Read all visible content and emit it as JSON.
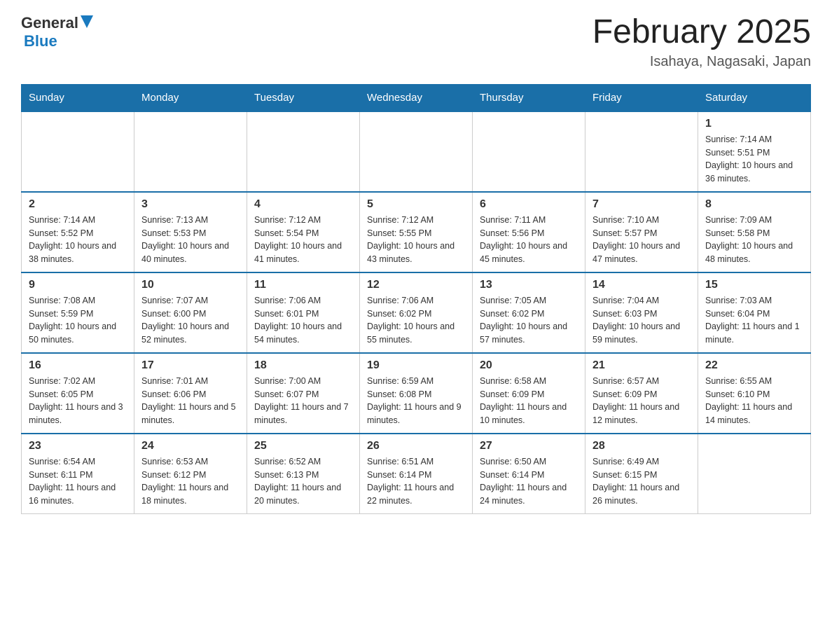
{
  "header": {
    "logo_general": "General",
    "logo_blue": "Blue",
    "title": "February 2025",
    "subtitle": "Isahaya, Nagasaki, Japan"
  },
  "weekdays": [
    "Sunday",
    "Monday",
    "Tuesday",
    "Wednesday",
    "Thursday",
    "Friday",
    "Saturday"
  ],
  "weeks": [
    [
      {
        "day": "",
        "info": ""
      },
      {
        "day": "",
        "info": ""
      },
      {
        "day": "",
        "info": ""
      },
      {
        "day": "",
        "info": ""
      },
      {
        "day": "",
        "info": ""
      },
      {
        "day": "",
        "info": ""
      },
      {
        "day": "1",
        "info": "Sunrise: 7:14 AM\nSunset: 5:51 PM\nDaylight: 10 hours\nand 36 minutes."
      }
    ],
    [
      {
        "day": "2",
        "info": "Sunrise: 7:14 AM\nSunset: 5:52 PM\nDaylight: 10 hours\nand 38 minutes."
      },
      {
        "day": "3",
        "info": "Sunrise: 7:13 AM\nSunset: 5:53 PM\nDaylight: 10 hours\nand 40 minutes."
      },
      {
        "day": "4",
        "info": "Sunrise: 7:12 AM\nSunset: 5:54 PM\nDaylight: 10 hours\nand 41 minutes."
      },
      {
        "day": "5",
        "info": "Sunrise: 7:12 AM\nSunset: 5:55 PM\nDaylight: 10 hours\nand 43 minutes."
      },
      {
        "day": "6",
        "info": "Sunrise: 7:11 AM\nSunset: 5:56 PM\nDaylight: 10 hours\nand 45 minutes."
      },
      {
        "day": "7",
        "info": "Sunrise: 7:10 AM\nSunset: 5:57 PM\nDaylight: 10 hours\nand 47 minutes."
      },
      {
        "day": "8",
        "info": "Sunrise: 7:09 AM\nSunset: 5:58 PM\nDaylight: 10 hours\nand 48 minutes."
      }
    ],
    [
      {
        "day": "9",
        "info": "Sunrise: 7:08 AM\nSunset: 5:59 PM\nDaylight: 10 hours\nand 50 minutes."
      },
      {
        "day": "10",
        "info": "Sunrise: 7:07 AM\nSunset: 6:00 PM\nDaylight: 10 hours\nand 52 minutes."
      },
      {
        "day": "11",
        "info": "Sunrise: 7:06 AM\nSunset: 6:01 PM\nDaylight: 10 hours\nand 54 minutes."
      },
      {
        "day": "12",
        "info": "Sunrise: 7:06 AM\nSunset: 6:02 PM\nDaylight: 10 hours\nand 55 minutes."
      },
      {
        "day": "13",
        "info": "Sunrise: 7:05 AM\nSunset: 6:02 PM\nDaylight: 10 hours\nand 57 minutes."
      },
      {
        "day": "14",
        "info": "Sunrise: 7:04 AM\nSunset: 6:03 PM\nDaylight: 10 hours\nand 59 minutes."
      },
      {
        "day": "15",
        "info": "Sunrise: 7:03 AM\nSunset: 6:04 PM\nDaylight: 11 hours\nand 1 minute."
      }
    ],
    [
      {
        "day": "16",
        "info": "Sunrise: 7:02 AM\nSunset: 6:05 PM\nDaylight: 11 hours\nand 3 minutes."
      },
      {
        "day": "17",
        "info": "Sunrise: 7:01 AM\nSunset: 6:06 PM\nDaylight: 11 hours\nand 5 minutes."
      },
      {
        "day": "18",
        "info": "Sunrise: 7:00 AM\nSunset: 6:07 PM\nDaylight: 11 hours\nand 7 minutes."
      },
      {
        "day": "19",
        "info": "Sunrise: 6:59 AM\nSunset: 6:08 PM\nDaylight: 11 hours\nand 9 minutes."
      },
      {
        "day": "20",
        "info": "Sunrise: 6:58 AM\nSunset: 6:09 PM\nDaylight: 11 hours\nand 10 minutes."
      },
      {
        "day": "21",
        "info": "Sunrise: 6:57 AM\nSunset: 6:09 PM\nDaylight: 11 hours\nand 12 minutes."
      },
      {
        "day": "22",
        "info": "Sunrise: 6:55 AM\nSunset: 6:10 PM\nDaylight: 11 hours\nand 14 minutes."
      }
    ],
    [
      {
        "day": "23",
        "info": "Sunrise: 6:54 AM\nSunset: 6:11 PM\nDaylight: 11 hours\nand 16 minutes."
      },
      {
        "day": "24",
        "info": "Sunrise: 6:53 AM\nSunset: 6:12 PM\nDaylight: 11 hours\nand 18 minutes."
      },
      {
        "day": "25",
        "info": "Sunrise: 6:52 AM\nSunset: 6:13 PM\nDaylight: 11 hours\nand 20 minutes."
      },
      {
        "day": "26",
        "info": "Sunrise: 6:51 AM\nSunset: 6:14 PM\nDaylight: 11 hours\nand 22 minutes."
      },
      {
        "day": "27",
        "info": "Sunrise: 6:50 AM\nSunset: 6:14 PM\nDaylight: 11 hours\nand 24 minutes."
      },
      {
        "day": "28",
        "info": "Sunrise: 6:49 AM\nSunset: 6:15 PM\nDaylight: 11 hours\nand 26 minutes."
      },
      {
        "day": "",
        "info": ""
      }
    ]
  ]
}
